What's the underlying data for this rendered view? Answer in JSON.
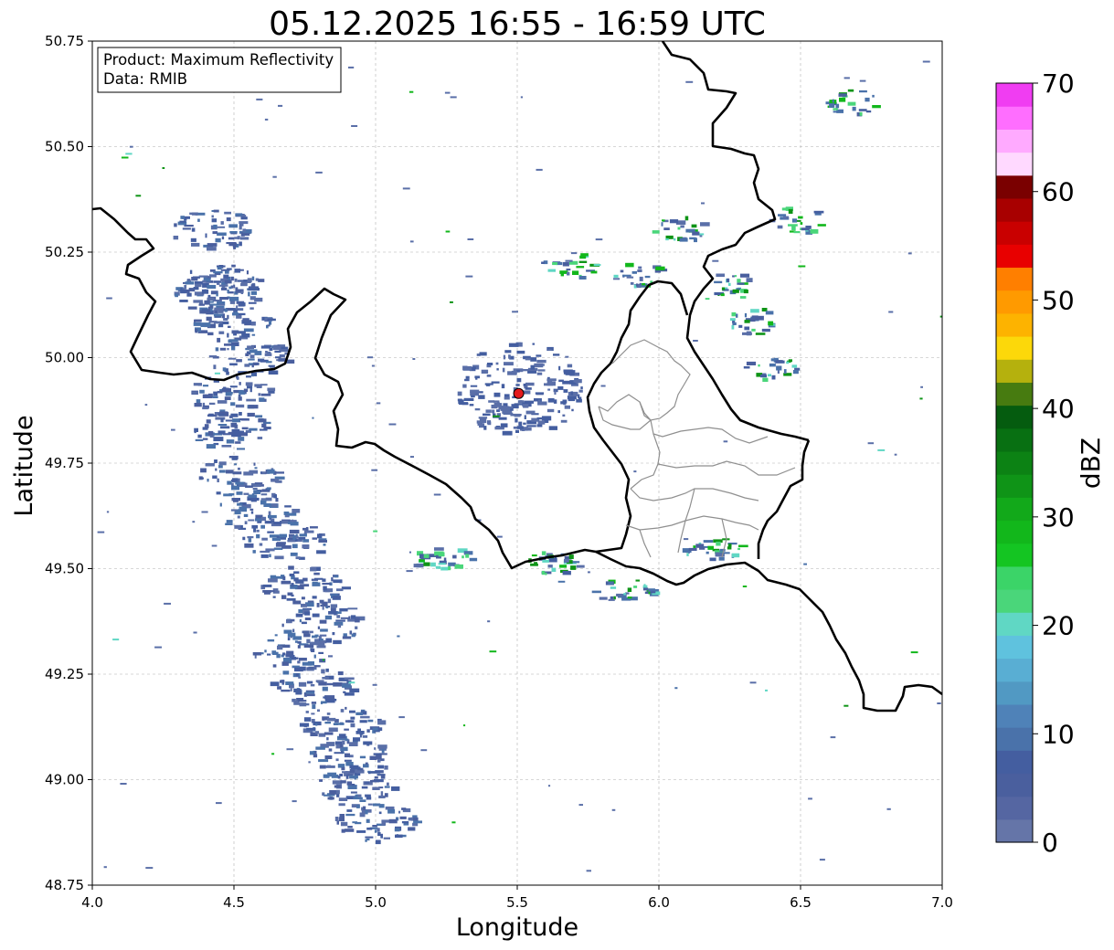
{
  "title": "05.12.2025 16:55 - 16:59 UTC",
  "info_box": {
    "line1": "Product: Maximum Reflectivity",
    "line2": "Data: RMIB"
  },
  "axes": {
    "xlabel": "Longitude",
    "ylabel": "Latitude",
    "xlim": [
      4.0,
      7.0
    ],
    "ylim": [
      48.75,
      50.75
    ],
    "xticks": [
      "4.0",
      "4.5",
      "5.0",
      "5.5",
      "6.0",
      "6.5",
      "7.0"
    ],
    "yticks": [
      "50.75",
      "50.50",
      "50.25",
      "50.00",
      "49.75",
      "49.50",
      "49.25",
      "49.00",
      "48.75"
    ],
    "grid": true
  },
  "radar_site": {
    "lon": 5.505,
    "lat": 49.915,
    "color": "#e31a1c"
  },
  "colorbar": {
    "label": "dBZ",
    "range": [
      0,
      70
    ],
    "step": 2.5,
    "ticks": [
      "0",
      "10",
      "20",
      "30",
      "40",
      "50",
      "60",
      "70"
    ],
    "colors": [
      "#6575a8",
      "#5566a2",
      "#4a5f9e",
      "#445ea0",
      "#4a72aa",
      "#4f82b8",
      "#5199c3",
      "#59aed3",
      "#5fc2de",
      "#60d7c4",
      "#4ad67a",
      "#3bd468",
      "#14c522",
      "#12b71b",
      "#12a91a",
      "#0f9417",
      "#0c8214",
      "#087012",
      "#055c0f",
      "#477b10",
      "#b5b10d",
      "#fcd80a",
      "#fdb300",
      "#ff9a00",
      "#ff7f00",
      "#e80000",
      "#c90000",
      "#a80000",
      "#7a0000",
      "#ffd9ff",
      "#ffaaff",
      "#ff6eff",
      "#f03df2"
    ]
  },
  "colors": {
    "border": "#000000",
    "district_border": "#8f8f8f",
    "grid": "#b0b0b0",
    "echo_low": "#5a6fa8"
  }
}
